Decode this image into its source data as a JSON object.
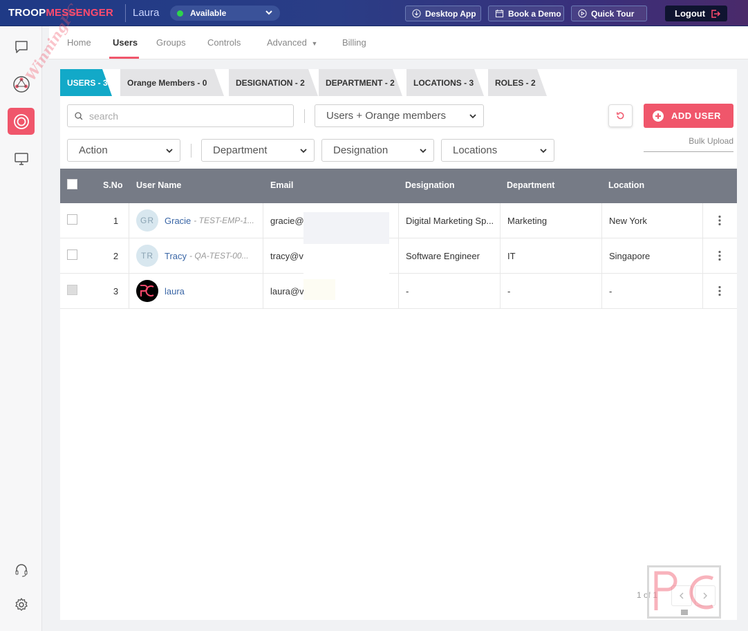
{
  "topbar": {
    "brand_part1": "TROOP",
    "brand_part2": "MESSENGER",
    "username": "Laura",
    "status": "Available",
    "desktop_app": "Desktop App",
    "book_demo": "Book a Demo",
    "quick_tour": "Quick Tour",
    "logout": "Logout"
  },
  "sidebar": {
    "icons": [
      "chat-icon",
      "globe-network-icon",
      "orbit-icon",
      "monitor-icon",
      "headset-icon",
      "settings-icon"
    ],
    "active": "orbit-icon"
  },
  "nav": {
    "items": [
      "Home",
      "Users",
      "Groups",
      "Controls",
      "Advanced",
      "Billing"
    ],
    "active": "Users"
  },
  "tabs": [
    {
      "label": "USERS - 3",
      "active": true
    },
    {
      "label": "Orange Members - 0",
      "active": false
    },
    {
      "label": "DESIGNATION - 2",
      "active": false
    },
    {
      "label": "DEPARTMENT - 2",
      "active": false
    },
    {
      "label": "LOCATIONS - 3",
      "active": false
    },
    {
      "label": "ROLES - 2",
      "active": false
    }
  ],
  "filters": {
    "search_placeholder": "search",
    "member_type": "Users + Orange members",
    "action": "Action",
    "department": "Department",
    "designation": "Designation",
    "locations": "Locations",
    "add_user": "ADD USER",
    "bulk_upload": "Bulk Upload"
  },
  "table": {
    "columns": [
      "S.No",
      "User Name",
      "Email",
      "Designation",
      "Department",
      "Location"
    ],
    "rows": [
      {
        "sno": "1",
        "initials": "GR",
        "name": "Gracie",
        "code": "- TEST-EMP-1...",
        "email": "gracie@v",
        "designation": "Digital Marketing Sp...",
        "department": "Marketing",
        "location": "New York"
      },
      {
        "sno": "2",
        "initials": "TR",
        "name": "Tracy",
        "code": "- QA-TEST-00...",
        "email": "tracy@v",
        "designation": "Software Engineer",
        "department": "IT",
        "location": "Singapore"
      },
      {
        "sno": "3",
        "initials": "",
        "name": "laura",
        "code": "",
        "email": "laura@v",
        "designation": "-",
        "department": "-",
        "location": "-"
      }
    ]
  },
  "pagination": {
    "info": "1 of 1"
  },
  "watermark": {
    "text": "WinningPC",
    "logo": "PC"
  },
  "colors": {
    "accent": "#f0566b",
    "tab_active": "#12a9c8",
    "header_bg": "#767b86",
    "topbar": "#2a3d86"
  }
}
